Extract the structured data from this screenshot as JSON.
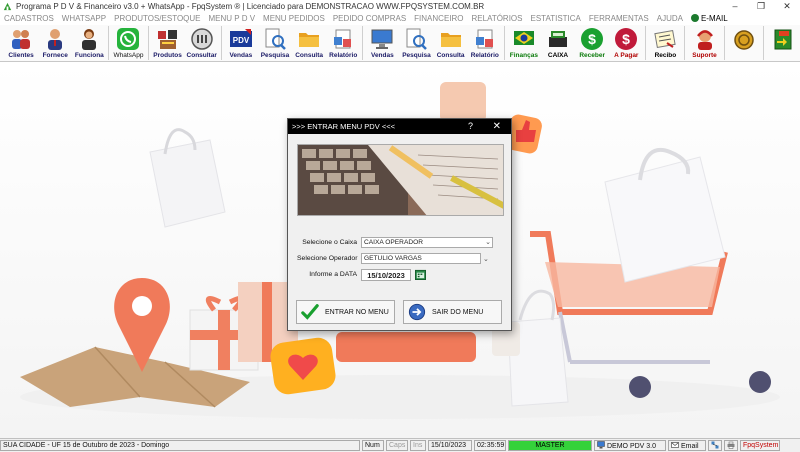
{
  "window": {
    "title": "Programa P D V & Financeiro v3.0 + WhatsApp - FpqSystem ® | Licenciado para  DEMONSTRACAO WWW.FPQSYSTEM.COM.BR",
    "minimize": "–",
    "maximize": "❐",
    "close": "✕"
  },
  "menu": {
    "items": [
      "CADASTROS",
      "WHATSAPP",
      "PRODUTOS/ESTOQUE",
      "MENU P D V",
      "MENU PEDIDOS",
      "PEDIDO COMPRAS",
      "FINANCEIRO",
      "RELATÓRIOS",
      "ESTATISTICA",
      "FERRAMENTAS",
      "AJUDA"
    ],
    "email": "E-MAIL"
  },
  "toolbar": {
    "clientes": "Clientes",
    "fornece": "Fornece",
    "funciona": "Funciona",
    "whatsapp": "WhatsApp",
    "produtos": "Produtos",
    "consultar": "Consultar",
    "vendas1": "Vendas",
    "pesquisa1": "Pesquisa",
    "consulta1": "Consulta",
    "relatorio1": "Relatório",
    "vendas2": "Vendas",
    "pesquisa2": "Pesquisa",
    "consulta2": "Consulta",
    "relatorio2": "Relatório",
    "financas": "Finanças",
    "caixa": "CAIXA",
    "receber": "Receber",
    "apagar": "A Pagar",
    "recibo": "Recibo",
    "suporte": "Suporte"
  },
  "dialog": {
    "title": ">>>  ENTRAR MENU PDV  <<<",
    "help": "?",
    "close": "✕",
    "caixa_label": "Selecione o Caixa",
    "caixa_value": "CAIXA OPERADOR",
    "operador_label": "Selecione Operador",
    "operador_value": "GETULIO VARGAS",
    "data_label": "Informe a DATA",
    "data_value": "15/10/2023",
    "enter_button": "ENTRAR NO MENU",
    "exit_button": "SAIR DO MENU"
  },
  "status": {
    "city": "SUA CIDADE - UF 15 de Outubro de 2023 - Domingo",
    "num": "Num",
    "caps": "Caps",
    "ins": "Ins",
    "date": "15/10/2023",
    "time": "02:35:59",
    "master": "MASTER",
    "demo": "DEMO PDV 3.0",
    "email": "Email",
    "fpq": "FpqSystem"
  },
  "colors": {
    "accent_red": "#b00000",
    "master_green": "#34d23a",
    "dialog_title_bg": "#000000"
  }
}
